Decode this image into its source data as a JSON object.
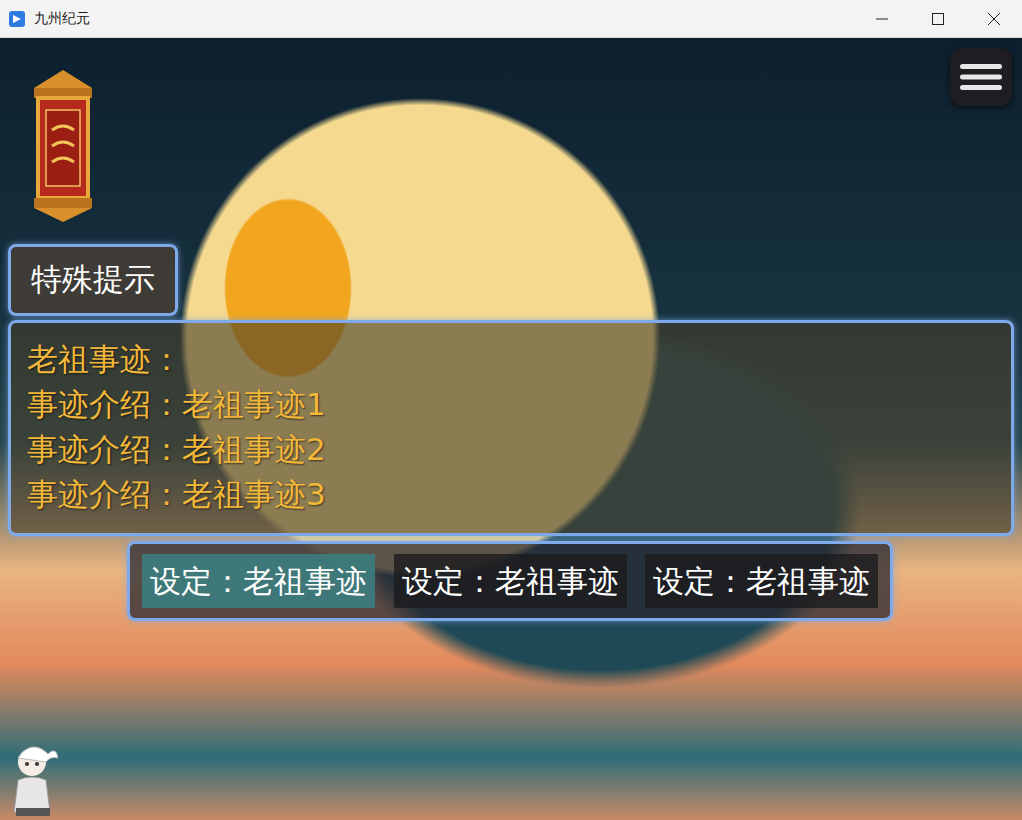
{
  "window": {
    "title": "九州纪元"
  },
  "prompt_button": {
    "label": "特殊提示"
  },
  "info_panel": {
    "heading": "老祖事迹：",
    "lines": [
      "事迹介绍：老祖事迹1",
      "事迹介绍：老祖事迹2",
      "事迹介绍：老祖事迹3"
    ]
  },
  "tabs": [
    {
      "label": "设定：老祖事迹",
      "selected": true
    },
    {
      "label": "设定：老祖事迹",
      "selected": false
    },
    {
      "label": "设定：老祖事迹",
      "selected": false
    }
  ]
}
